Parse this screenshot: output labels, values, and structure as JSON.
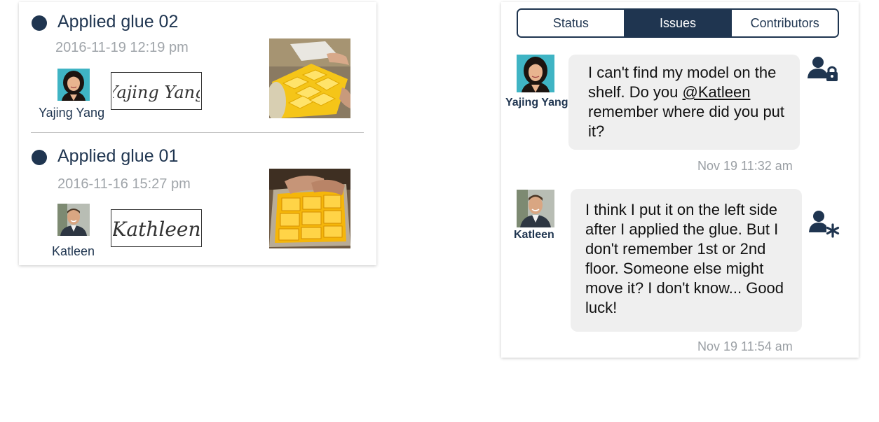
{
  "log": {
    "entries": [
      {
        "title": "Applied glue 02",
        "date": "2016-11-19 12:19 pm",
        "user": "Yajing Yang",
        "signature": "Yajing Yang"
      },
      {
        "title": "Applied glue 01",
        "date": "2016-11-16 15:27 pm",
        "user": "Katleen",
        "signature": "Kathleen"
      }
    ]
  },
  "tabs": [
    {
      "label": "Status",
      "active": false
    },
    {
      "label": "Issues",
      "active": true
    },
    {
      "label": "Contributors",
      "active": false
    }
  ],
  "messages": [
    {
      "author": "Yajing Yang",
      "text_before": "I can't find my model on the shelf. Do you ",
      "mention": "@Katleen",
      "text_after": " remember where did you put it?",
      "time": "Nov 19 11:32 am",
      "role_icon": "user-lock-icon"
    },
    {
      "author": "Katleen",
      "text": "I think I put it on the left side after I applied the glue. But I don't remember 1st or 2nd floor. Someone else might move it? I don't know... Good luck!",
      "time": "Nov 19 11:54 am",
      "role_icon": "user-asterisk-icon"
    }
  ],
  "colors": {
    "navy": "#1f3550",
    "muted": "#a0a5aa",
    "bubble": "#efefef",
    "glue_yellow": "#f5c518"
  }
}
